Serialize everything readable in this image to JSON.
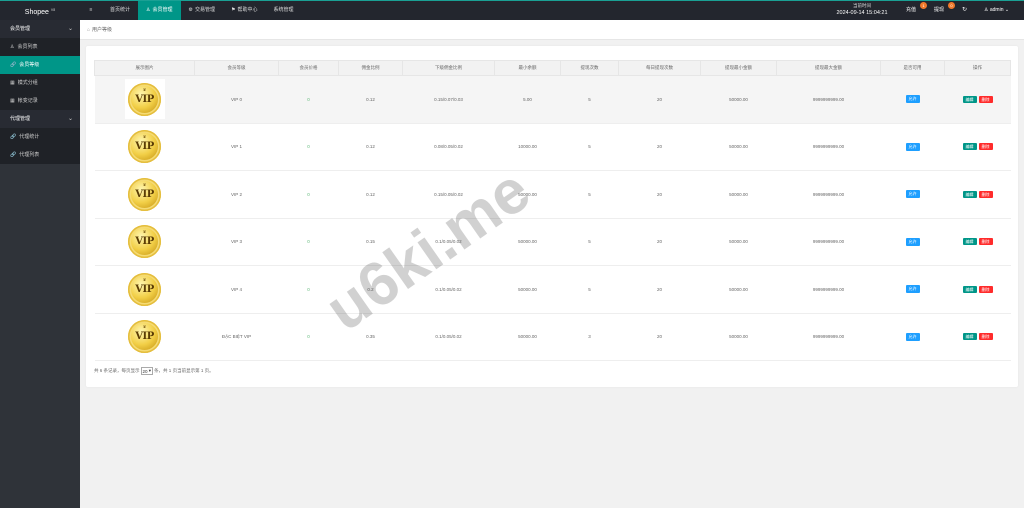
{
  "app": {
    "title": "Shopee",
    "version": "V8"
  },
  "topnav": [
    {
      "icon": "≡",
      "label": ""
    },
    {
      "icon": "",
      "label": "首页统计"
    },
    {
      "icon": "♙",
      "label": "会员管理"
    },
    {
      "icon": "⚙",
      "label": "交易管理"
    },
    {
      "icon": "⚑",
      "label": "帮助中心"
    },
    {
      "icon": "",
      "label": "系统管理"
    }
  ],
  "clock": {
    "label": "当前时间",
    "time": "2024-09-14 15:04:21"
  },
  "topright": {
    "recharge": "充值",
    "recharge_badge": "1",
    "withdraw": "提现",
    "withdraw_badge": "0",
    "refresh": "↻",
    "user": "admin"
  },
  "sidebar": {
    "group1": "会员管理",
    "items1": [
      {
        "icon": "♙",
        "label": "会员列表"
      },
      {
        "icon": "🔗",
        "label": "会员等级"
      },
      {
        "icon": "▦",
        "label": "模式分组"
      },
      {
        "icon": "▦",
        "label": "帐变记录"
      }
    ],
    "group2": "代理管理",
    "items2": [
      {
        "icon": "🔗",
        "label": "代理统计"
      },
      {
        "icon": "🔗",
        "label": "代理列表"
      }
    ]
  },
  "breadcrumb": {
    "icon": "⌂",
    "label": "用户等级"
  },
  "table": {
    "headers": [
      "展示图片",
      "会员等级",
      "会员价格",
      "佣金比例",
      "下级佣金比例",
      "最小余额",
      "提现次数",
      "每日提现次数",
      "提现最小金额",
      "提现最大金额",
      "是否可用",
      "操作"
    ],
    "rows": [
      {
        "image": "VIP",
        "level": "VIP 0",
        "price": "0",
        "commission": "0.12",
        "sub_commission": "0.15/0.07/0.03",
        "min_balance": "5.00",
        "withdraw_times": "5",
        "daily_withdraw": "20",
        "withdraw_min": "50000.00",
        "withdraw_max": "9999999999.00",
        "status": "允许",
        "edit": "编辑",
        "delete": "删除"
      },
      {
        "image": "VIP",
        "level": "VIP 1",
        "price": "0",
        "commission": "0.12",
        "sub_commission": "0.08/0.05/0.02",
        "min_balance": "10000.00",
        "withdraw_times": "5",
        "daily_withdraw": "20",
        "withdraw_min": "50000.00",
        "withdraw_max": "9999999999.00",
        "status": "允许",
        "edit": "编辑",
        "delete": "删除"
      },
      {
        "image": "VIP",
        "level": "VIP 2",
        "price": "0",
        "commission": "0.12",
        "sub_commission": "0.15/0.05/0.02",
        "min_balance": "50000.00",
        "withdraw_times": "5",
        "daily_withdraw": "20",
        "withdraw_min": "50000.00",
        "withdraw_max": "9999999999.00",
        "status": "允许",
        "edit": "编辑",
        "delete": "删除"
      },
      {
        "image": "VIP",
        "level": "VIP 3",
        "price": "0",
        "commission": "0.15",
        "sub_commission": "0.1/0.05/0.02",
        "min_balance": "50000.00",
        "withdraw_times": "5",
        "daily_withdraw": "20",
        "withdraw_min": "50000.00",
        "withdraw_max": "9999999999.00",
        "status": "允许",
        "edit": "编辑",
        "delete": "删除"
      },
      {
        "image": "VIP",
        "level": "VIP 4",
        "price": "0",
        "commission": "0.2",
        "sub_commission": "0.1/0.05/0.02",
        "min_balance": "50000.00",
        "withdraw_times": "5",
        "daily_withdraw": "20",
        "withdraw_min": "50000.00",
        "withdraw_max": "9999999999.00",
        "status": "允许",
        "edit": "编辑",
        "delete": "删除"
      },
      {
        "image": "VIP",
        "level": "ĐẶC BIỆT VIP",
        "price": "0",
        "commission": "0.35",
        "sub_commission": "0.1/0.05/0.02",
        "min_balance": "50000.00",
        "withdraw_times": "3",
        "daily_withdraw": "20",
        "withdraw_min": "50000.00",
        "withdraw_max": "9999999999.00",
        "status": "允许",
        "edit": "编辑",
        "delete": "删除"
      }
    ]
  },
  "pager": {
    "prefix": "共 6 条记录，每页显示",
    "page_size": "20",
    "suffix": "条，共 1 页当前显示第 1 页。"
  },
  "watermark": "u6ki.me",
  "colors": {
    "accent": "#009688",
    "topbar": "#23262e",
    "sidebar": "#2f3339",
    "blue": "#1e9fff",
    "red": "#ff2b2b",
    "green": "#5fb878"
  }
}
